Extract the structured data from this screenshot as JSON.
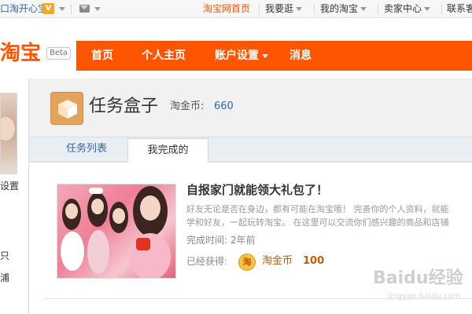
{
  "topbar": {
    "happy_store": "口淘开心宝",
    "home_link": "淘宝网首页",
    "want": "我要逛",
    "my_taobao": "我的淘宝",
    "seller_center": "卖家中心",
    "contact": "联系客"
  },
  "header": {
    "logo_text": "淘宝",
    "beta": "Beta",
    "nav": [
      "首页",
      "个人主页",
      "账户设置",
      "消息"
    ]
  },
  "sidebar": {
    "settings": "设置",
    "item1": "只",
    "item2": "浦"
  },
  "main": {
    "title": "任务盒子",
    "coin_label": "淘金币:",
    "coin_value": "660",
    "tabs": [
      "任务列表",
      "我完成的"
    ]
  },
  "task": {
    "title": "自报家门就能领大礼包了！",
    "desc_line1": "好友无论是否在身边，都有可能在淘宝哦！ 完善你的个人资料，就能",
    "desc_line2": "学和好友，一起玩转淘宝。 在这里可以交流你们感兴趣的商品和店铺",
    "time_label": "完成时间:",
    "time_value": "2年前",
    "earned_label": "已经获得:",
    "coin_icon_text": "淘",
    "earned_unit": "淘金币",
    "earned_value": "100"
  },
  "watermark": {
    "main": "Baidu经验",
    "sub": "jingyan.baidu.com"
  },
  "colors": {
    "brand": "#ff5500",
    "link": "#3366aa",
    "coin": "#c25e00"
  }
}
